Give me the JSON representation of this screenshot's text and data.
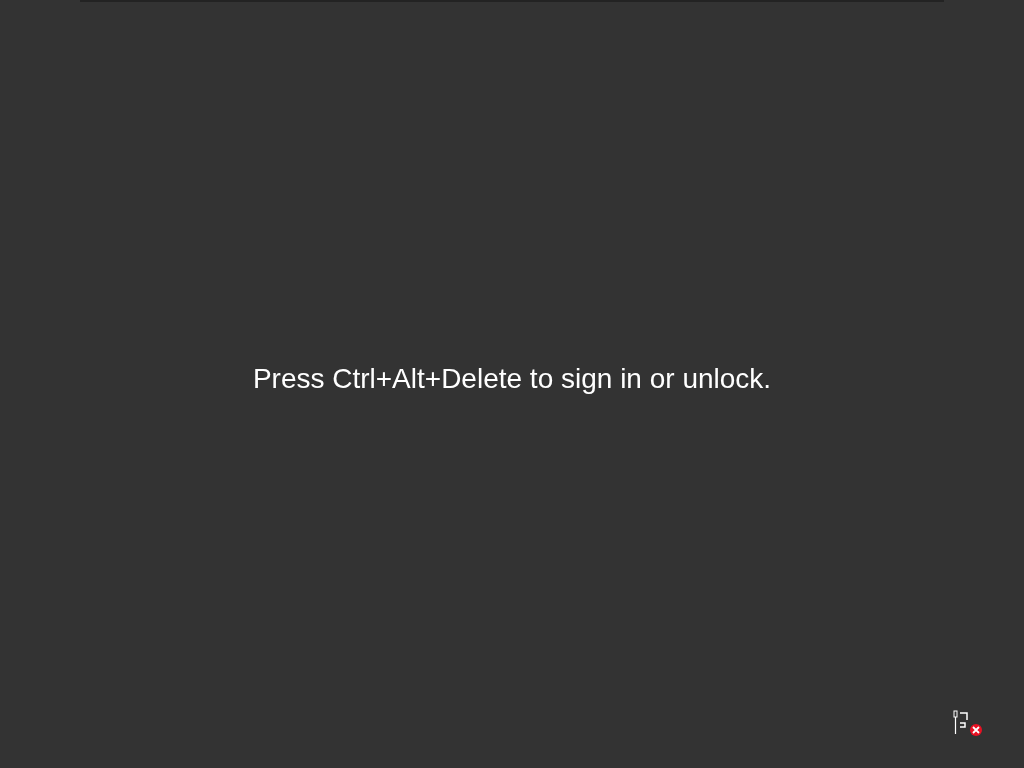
{
  "message": "Press Ctrl+Alt+Delete to sign in or unlock.",
  "network": {
    "connected": false
  }
}
